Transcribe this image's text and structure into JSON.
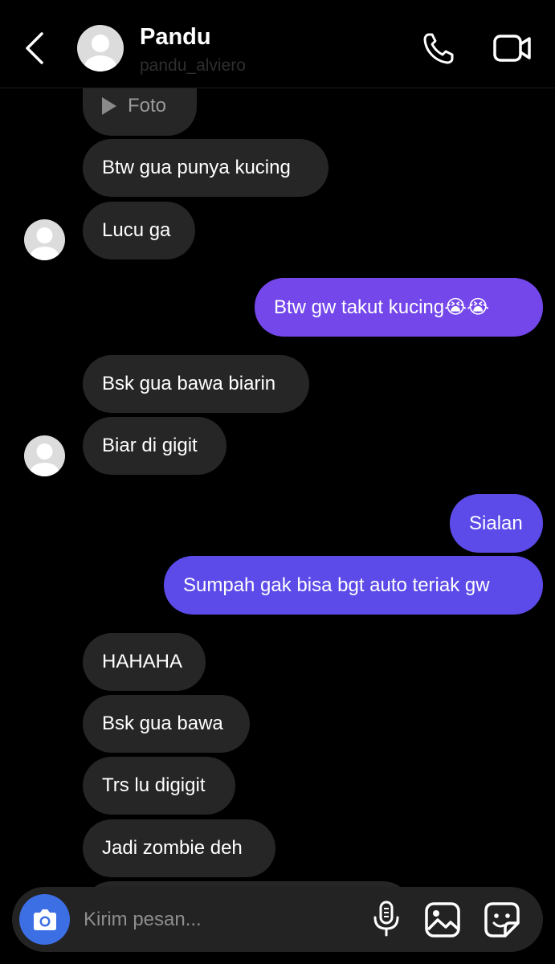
{
  "header": {
    "name": "Pandu",
    "username": "pandu_alviero"
  },
  "messages": {
    "foto_label": "Foto",
    "m1": "Btw gua punya kucing",
    "m2": "Lucu ga",
    "m3": "Btw gw takut kucing😭😭",
    "m4": "Bsk gua bawa biarin",
    "m5": "Biar di gigit",
    "m6": "Sialan",
    "m7": "Sumpah gak bisa bgt auto teriak gw",
    "m8": "HAHAHA",
    "m9": "Bsk gua bawa",
    "m10": "Trs lu digigit",
    "m11": "Jadi zombie deh"
  },
  "composer": {
    "placeholder": "Kirim pesan..."
  },
  "colors": {
    "outgoing_1": "#7447ea",
    "outgoing_2": "#5c4be8",
    "incoming": "#262626",
    "camera_button": "#3c6fe4"
  },
  "icons": [
    "back-icon",
    "call-icon",
    "video-call-icon",
    "camera-icon",
    "microphone-icon",
    "gallery-icon",
    "sticker-icon",
    "play-icon"
  ]
}
